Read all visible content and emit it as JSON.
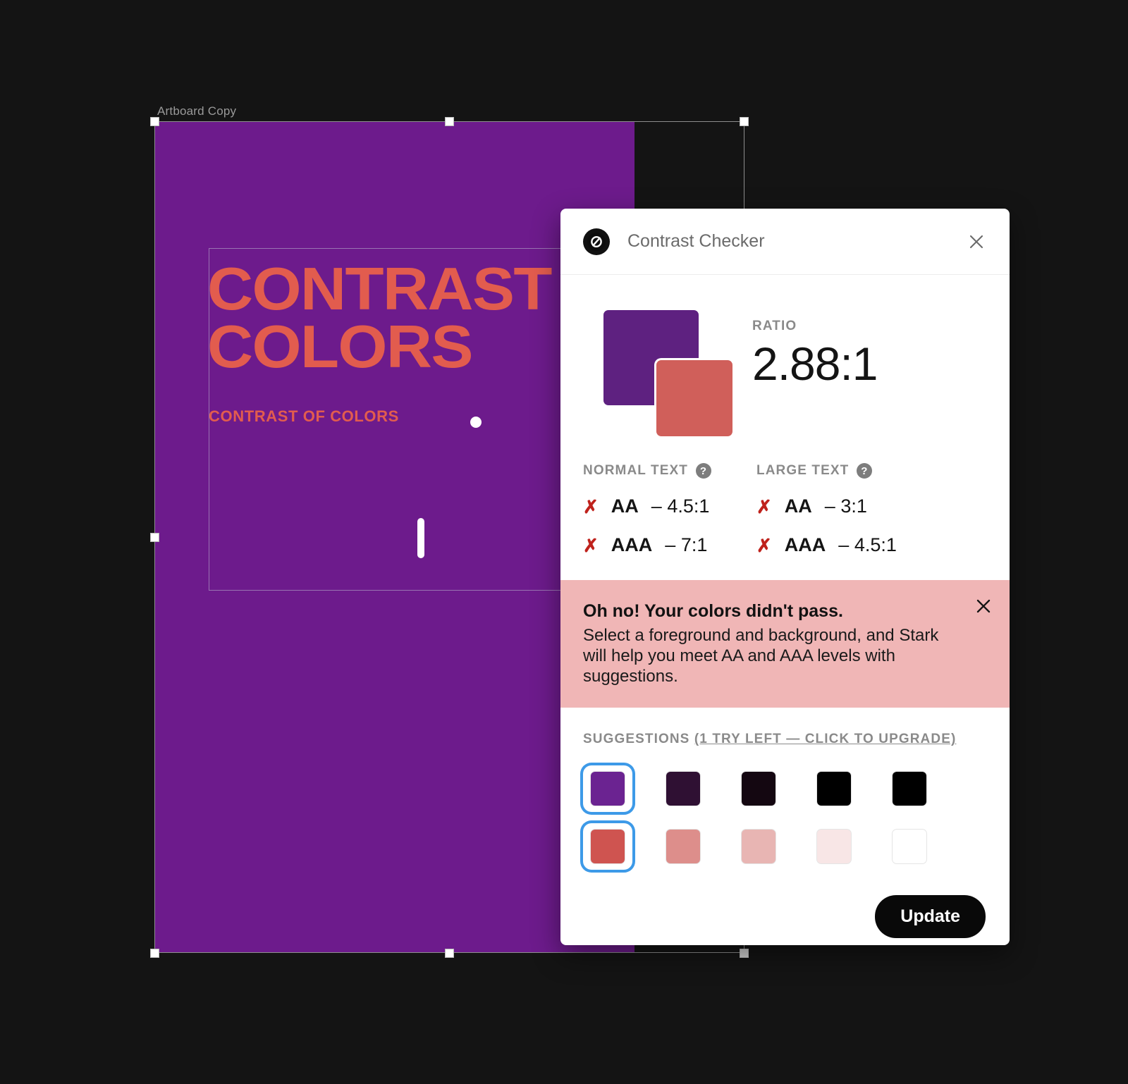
{
  "canvas": {
    "background_color": "#141414",
    "artboard_label": "Artboard Copy",
    "artboard_color": "#6d1b8c",
    "headline": "CONTRAST COLORS",
    "subhead": "CONTRAST OF COLORS",
    "text_color": "#e25c4e"
  },
  "panel": {
    "title": "Contrast Checker",
    "logo_icon": "stark-logo-icon",
    "close_icon": "close-icon",
    "ratio": {
      "label": "RATIO",
      "value": "2.88:1",
      "background_swatch": "#5e2180",
      "foreground_swatch": "#d05f5a"
    },
    "levels": [
      {
        "heading": "NORMAL TEXT",
        "help_icon": "question-mark-icon",
        "rows": [
          {
            "status_icon": "x-icon",
            "passed": false,
            "grade": "AA",
            "ratio": "– 4.5:1"
          },
          {
            "status_icon": "x-icon",
            "passed": false,
            "grade": "AAA",
            "ratio": "– 7:1"
          }
        ]
      },
      {
        "heading": "LARGE TEXT",
        "help_icon": "question-mark-icon",
        "rows": [
          {
            "status_icon": "x-icon",
            "passed": false,
            "grade": "AA",
            "ratio": "– 3:1"
          },
          {
            "status_icon": "x-icon",
            "passed": false,
            "grade": "AAA",
            "ratio": "– 4.5:1"
          }
        ]
      }
    ],
    "alert": {
      "title": "Oh no! Your colors didn't pass.",
      "body": "Select a foreground and background, and Stark will help you meet AA and AAA levels with suggestions.",
      "background_color": "#f0b6b6",
      "close_icon": "close-icon"
    },
    "suggestions": {
      "label": "SUGGESTIONS",
      "link": "(1 TRY LEFT — CLICK TO UPGRADE)",
      "selection_color": "#3d9ae8",
      "rows": [
        {
          "name": "background-swatches",
          "swatches": [
            {
              "color": "#6b2391",
              "selected": true
            },
            {
              "color": "#2f1033",
              "selected": false
            },
            {
              "color": "#140711",
              "selected": false
            },
            {
              "color": "#000000",
              "selected": false
            },
            {
              "color": "#000000",
              "selected": false
            }
          ]
        },
        {
          "name": "foreground-swatches",
          "swatches": [
            {
              "color": "#cf5450",
              "selected": true
            },
            {
              "color": "#dd8e8b",
              "selected": false
            },
            {
              "color": "#e8b5b3",
              "selected": false
            },
            {
              "color": "#f8e6e6",
              "selected": false
            },
            {
              "color": "#ffffff",
              "selected": false
            }
          ]
        }
      ]
    },
    "update_button": "Update"
  }
}
